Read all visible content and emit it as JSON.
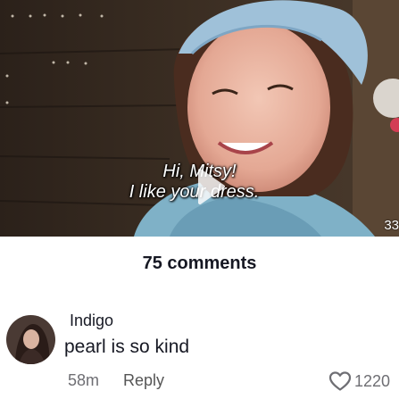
{
  "video": {
    "caption_line1": "Hi, Mitsy!",
    "caption_line2": "I like your dress.",
    "counter": "33"
  },
  "comments": {
    "title": "75 comments",
    "items": [
      {
        "username": "Indigo",
        "text": "pearl is so kind",
        "time": "58m",
        "reply_label": "Reply",
        "likes": "1220"
      }
    ]
  },
  "colors": {
    "text_primary": "#161823",
    "text_secondary": "#6e6e73"
  },
  "icons": {
    "play": "play-icon",
    "like": "heart-icon"
  }
}
